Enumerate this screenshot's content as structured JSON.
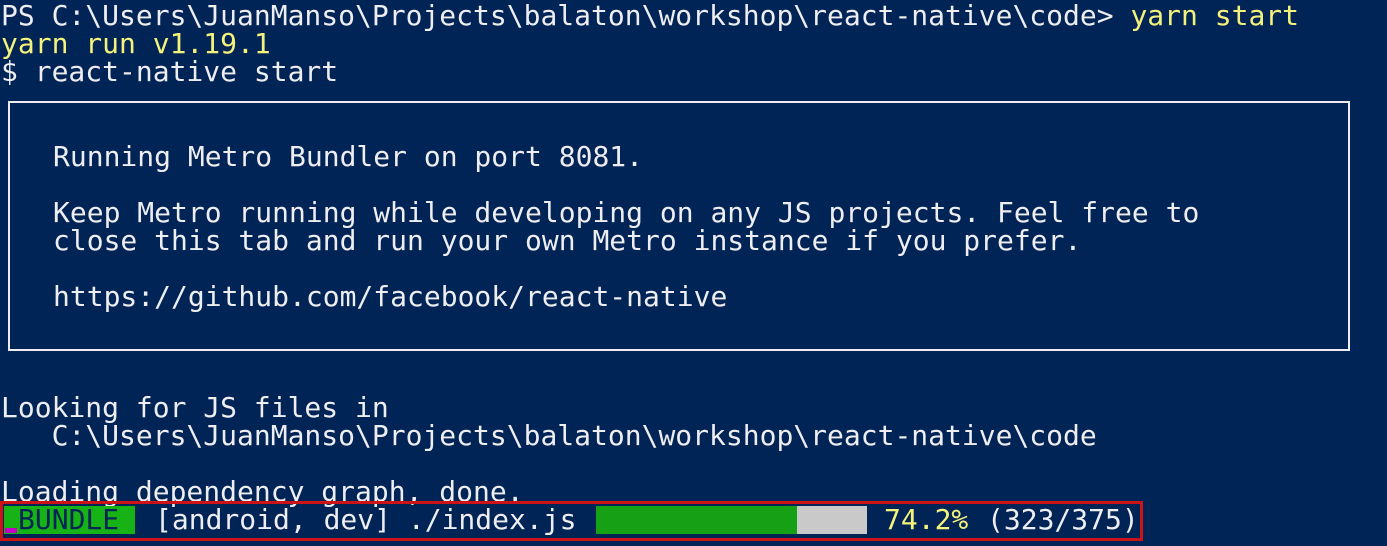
{
  "terminal": {
    "prompt": "PS C:\\Users\\JuanManso\\Projects\\balaton\\workshop\\react-native\\code>",
    "command": " yarn start",
    "yarn_version_line": "yarn run v1.19.1",
    "shell_line": "$ react-native start",
    "metro_box": {
      "line1": "Running Metro Bundler on port 8081.",
      "line2": "Keep Metro running while developing on any JS projects. Feel free to",
      "line3": "close this tab and run your own Metro instance if you prefer.",
      "line4": "https://github.com/facebook/react-native"
    },
    "looking_line": "Looking for JS files in",
    "project_path": "   C:\\Users\\JuanManso\\Projects\\balaton\\workshop\\react-native\\code",
    "loading_line": "Loading dependency graph, done.",
    "bundle": {
      "badge": "BUNDLE",
      "target": "[android, dev] ./index.js",
      "progress_percent": 74.2,
      "progress_text": "74.2%",
      "counts": "(323/375)"
    }
  },
  "colors": {
    "background": "#012456",
    "foreground": "#eeedf0",
    "highlight_yellow": "#f5f27c",
    "bundle_green": "#16b216",
    "progress_green": "#16a016",
    "progress_track": "#c9c9c9",
    "status_border_red": "#cc1417"
  }
}
